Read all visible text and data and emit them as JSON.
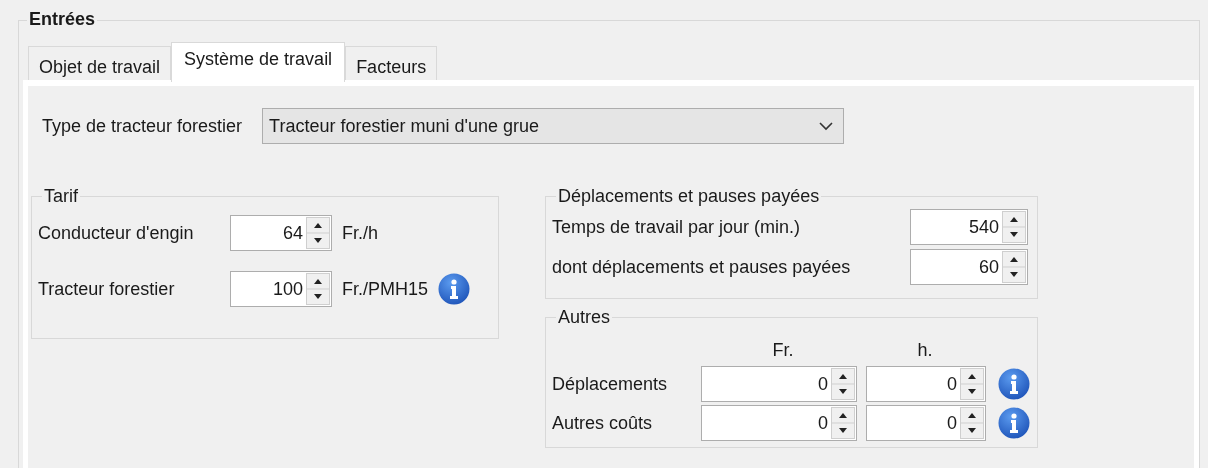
{
  "group_title": "Entrées",
  "tabs": [
    {
      "label": "Objet de travail",
      "selected": false
    },
    {
      "label": "Système de travail",
      "selected": true
    },
    {
      "label": "Facteurs",
      "selected": false
    }
  ],
  "tractor_type": {
    "label": "Type de tracteur forestier",
    "value": "Tracteur forestier muni d'une grue"
  },
  "tarif": {
    "title": "Tarif",
    "rows": [
      {
        "label": "Conducteur d'engin",
        "value": "64",
        "unit": "Fr./h",
        "info": false
      },
      {
        "label": "Tracteur forestier",
        "value": "100",
        "unit": "Fr./PMH15",
        "info": true
      }
    ]
  },
  "travel": {
    "title": "Déplacements et pauses payées",
    "rows": [
      {
        "label": "Temps de travail par jour (min.)",
        "value": "540"
      },
      {
        "label": "dont déplacements et pauses payées",
        "value": "60"
      }
    ]
  },
  "others": {
    "title": "Autres",
    "columns": [
      "Fr.",
      "h."
    ],
    "rows": [
      {
        "label": "Déplacements",
        "values": [
          "0",
          "0"
        ],
        "info": true
      },
      {
        "label": "Autres coûts",
        "values": [
          "0",
          "0"
        ],
        "info": true
      }
    ]
  }
}
